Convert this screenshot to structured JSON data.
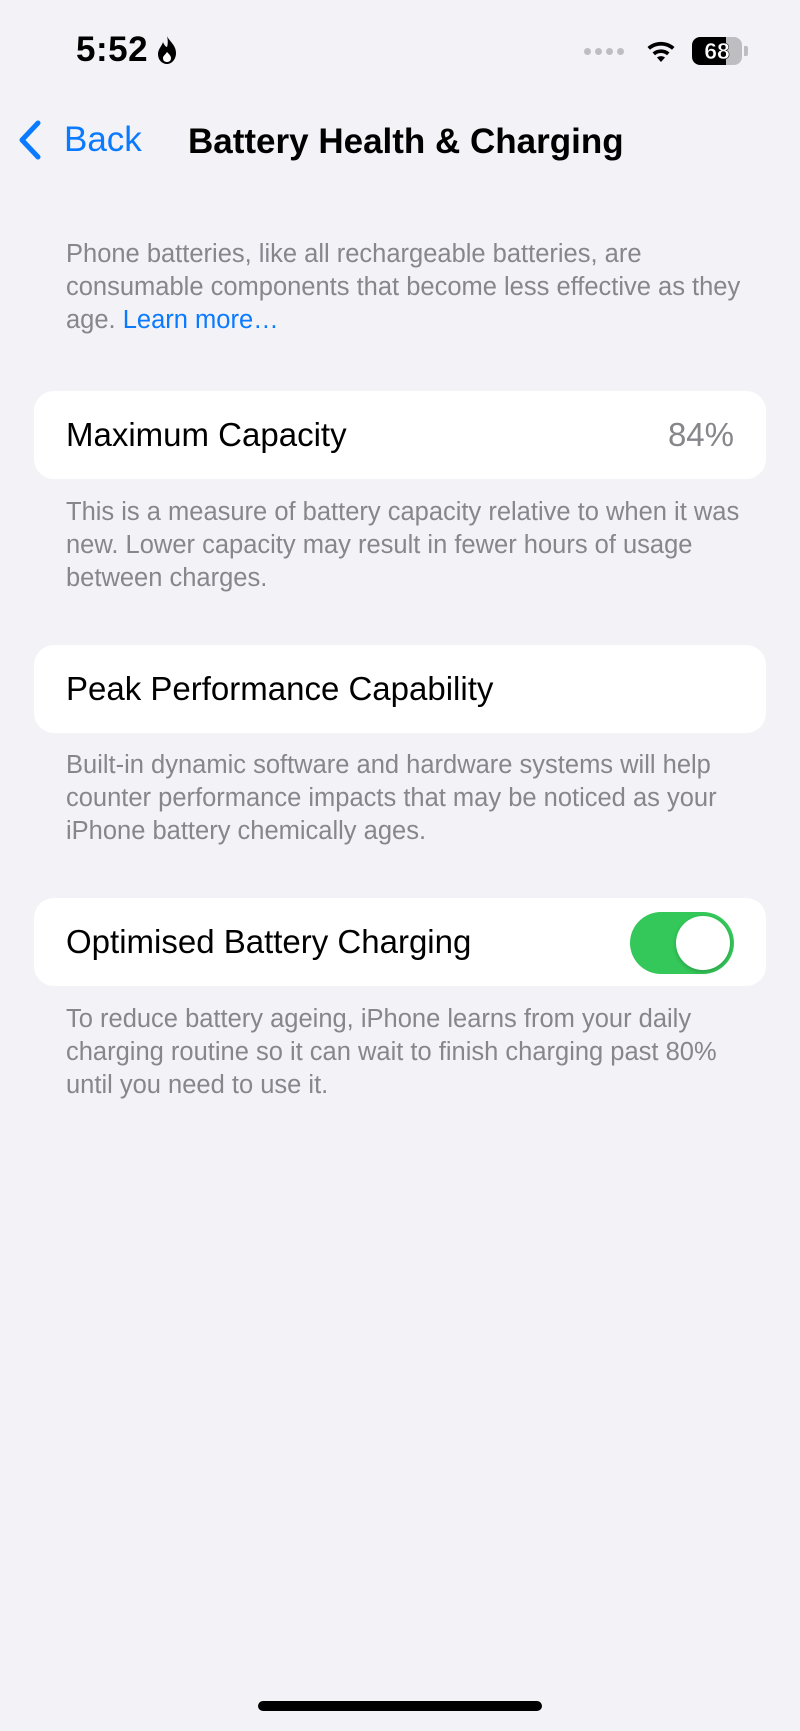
{
  "status_bar": {
    "time": "5:52",
    "battery_level": "68",
    "battery_fraction": 0.68
  },
  "nav": {
    "back_label": "Back",
    "title": "Battery Health & Charging"
  },
  "intro": {
    "text": "Phone batteries, like all rechargeable batteries, are consumable components that become less effective as they age. ",
    "link": "Learn more…"
  },
  "maximum_capacity": {
    "label": "Maximum Capacity",
    "value": "84%",
    "footnote": "This is a measure of battery capacity relative to when it was new. Lower capacity may result in fewer hours of usage between charges."
  },
  "peak_performance": {
    "label": "Peak Performance Capability",
    "footnote": "Built-in dynamic software and hardware systems will help counter performance impacts that may be noticed as your iPhone battery chemically ages."
  },
  "optimised_charging": {
    "label": "Optimised Battery Charging",
    "enabled": true,
    "footnote": "To reduce battery ageing, iPhone learns from your daily charging routine so it can wait to finish charging past 80% until you need to use it."
  },
  "colors": {
    "accent": "#0a7aff",
    "toggle_on": "#34c759",
    "background": "#f2f2f7",
    "secondary_text": "#86868b"
  },
  "icons": {
    "focus": "flame-icon",
    "cellular": "signal-dots-icon",
    "wifi": "wifi-icon",
    "battery": "battery-icon",
    "back": "chevron-left-icon"
  }
}
